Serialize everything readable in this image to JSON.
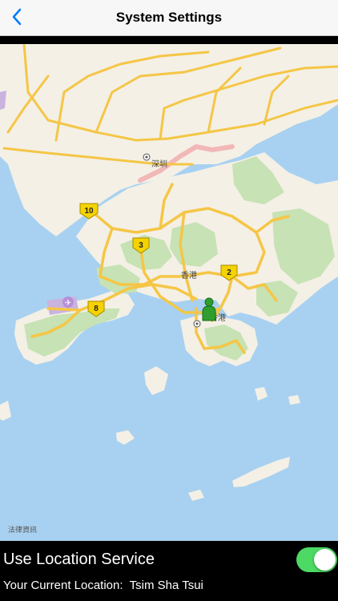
{
  "header": {
    "title": "System Settings"
  },
  "map": {
    "place_labels": [
      "深圳",
      "香港",
      "香港"
    ],
    "route_shields": [
      "10",
      "3",
      "2",
      "8"
    ],
    "legal_text": "法律資訊",
    "colors": {
      "water": "#a8d1f1",
      "land": "#f4f0e6",
      "park": "#c7e2b4",
      "road": "#f5c646",
      "border": "#f2b7b7"
    }
  },
  "settings": {
    "location_service_label": "Use Location Service",
    "location_service_enabled": true,
    "current_location_label": "Your Current Location:",
    "current_location_value": "Tsim Sha Tsui",
    "toggle_color": "#4cd964"
  }
}
